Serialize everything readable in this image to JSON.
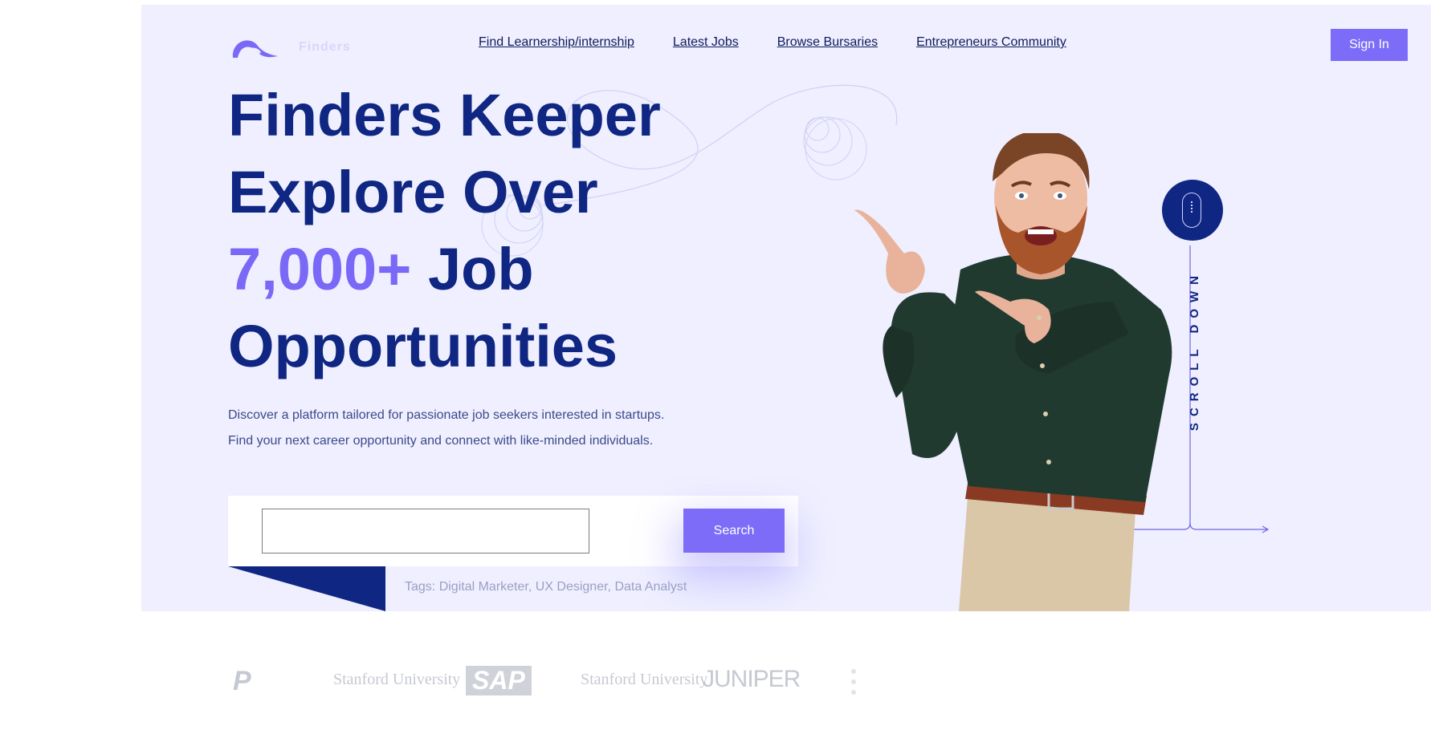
{
  "brand": {
    "name": "Finders"
  },
  "nav": {
    "links": [
      "Find Learnership/internship",
      "Latest Jobs",
      "Browse Bursaries",
      "Entrepreneurs Community"
    ],
    "sign_in": "Sign In"
  },
  "hero": {
    "line1": "Finders Keeper",
    "line2": "Explore Over",
    "count": "7,000+",
    "line3_rest": " Job",
    "line4": "Opportunities",
    "sub1": "Discover a platform tailored for passionate job seekers interested in startups.",
    "sub2": "Find your next career opportunity and connect with like-minded individuals."
  },
  "search": {
    "value": "",
    "placeholder": "",
    "button": "Search",
    "tags": "Tags: Digital Marketer, UX Designer, Data Analyst"
  },
  "scroll": {
    "label": "SCROLL DOWN",
    "icon": "mouse-icon"
  },
  "partners": {
    "items": [
      "P",
      "Stanford University",
      "SAP",
      "Stanford University",
      "JUNIPER"
    ]
  },
  "colors": {
    "hero_bg": "#efefff",
    "primary_dark": "#0f2682",
    "accent": "#7a68f6",
    "button": "#7c6cf8"
  }
}
